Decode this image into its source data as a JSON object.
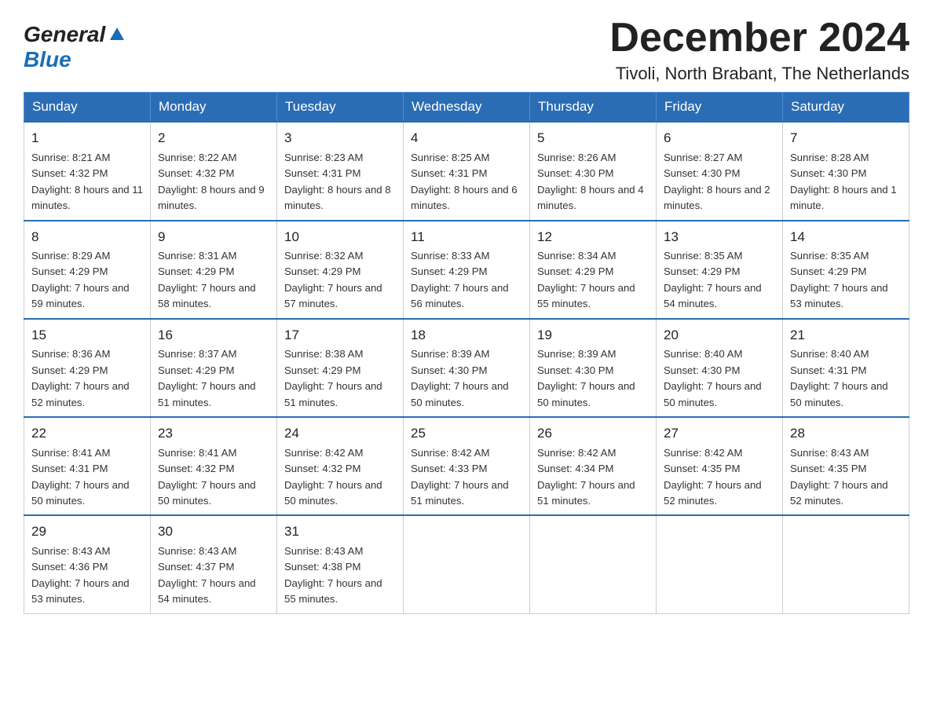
{
  "header": {
    "logo_general": "General",
    "logo_blue": "Blue",
    "title": "December 2024",
    "subtitle": "Tivoli, North Brabant, The Netherlands"
  },
  "days_of_week": [
    "Sunday",
    "Monday",
    "Tuesday",
    "Wednesday",
    "Thursday",
    "Friday",
    "Saturday"
  ],
  "weeks": [
    [
      {
        "day": "1",
        "sunrise": "8:21 AM",
        "sunset": "4:32 PM",
        "daylight": "8 hours and 11 minutes."
      },
      {
        "day": "2",
        "sunrise": "8:22 AM",
        "sunset": "4:32 PM",
        "daylight": "8 hours and 9 minutes."
      },
      {
        "day": "3",
        "sunrise": "8:23 AM",
        "sunset": "4:31 PM",
        "daylight": "8 hours and 8 minutes."
      },
      {
        "day": "4",
        "sunrise": "8:25 AM",
        "sunset": "4:31 PM",
        "daylight": "8 hours and 6 minutes."
      },
      {
        "day": "5",
        "sunrise": "8:26 AM",
        "sunset": "4:30 PM",
        "daylight": "8 hours and 4 minutes."
      },
      {
        "day": "6",
        "sunrise": "8:27 AM",
        "sunset": "4:30 PM",
        "daylight": "8 hours and 2 minutes."
      },
      {
        "day": "7",
        "sunrise": "8:28 AM",
        "sunset": "4:30 PM",
        "daylight": "8 hours and 1 minute."
      }
    ],
    [
      {
        "day": "8",
        "sunrise": "8:29 AM",
        "sunset": "4:29 PM",
        "daylight": "7 hours and 59 minutes."
      },
      {
        "day": "9",
        "sunrise": "8:31 AM",
        "sunset": "4:29 PM",
        "daylight": "7 hours and 58 minutes."
      },
      {
        "day": "10",
        "sunrise": "8:32 AM",
        "sunset": "4:29 PM",
        "daylight": "7 hours and 57 minutes."
      },
      {
        "day": "11",
        "sunrise": "8:33 AM",
        "sunset": "4:29 PM",
        "daylight": "7 hours and 56 minutes."
      },
      {
        "day": "12",
        "sunrise": "8:34 AM",
        "sunset": "4:29 PM",
        "daylight": "7 hours and 55 minutes."
      },
      {
        "day": "13",
        "sunrise": "8:35 AM",
        "sunset": "4:29 PM",
        "daylight": "7 hours and 54 minutes."
      },
      {
        "day": "14",
        "sunrise": "8:35 AM",
        "sunset": "4:29 PM",
        "daylight": "7 hours and 53 minutes."
      }
    ],
    [
      {
        "day": "15",
        "sunrise": "8:36 AM",
        "sunset": "4:29 PM",
        "daylight": "7 hours and 52 minutes."
      },
      {
        "day": "16",
        "sunrise": "8:37 AM",
        "sunset": "4:29 PM",
        "daylight": "7 hours and 51 minutes."
      },
      {
        "day": "17",
        "sunrise": "8:38 AM",
        "sunset": "4:29 PM",
        "daylight": "7 hours and 51 minutes."
      },
      {
        "day": "18",
        "sunrise": "8:39 AM",
        "sunset": "4:30 PM",
        "daylight": "7 hours and 50 minutes."
      },
      {
        "day": "19",
        "sunrise": "8:39 AM",
        "sunset": "4:30 PM",
        "daylight": "7 hours and 50 minutes."
      },
      {
        "day": "20",
        "sunrise": "8:40 AM",
        "sunset": "4:30 PM",
        "daylight": "7 hours and 50 minutes."
      },
      {
        "day": "21",
        "sunrise": "8:40 AM",
        "sunset": "4:31 PM",
        "daylight": "7 hours and 50 minutes."
      }
    ],
    [
      {
        "day": "22",
        "sunrise": "8:41 AM",
        "sunset": "4:31 PM",
        "daylight": "7 hours and 50 minutes."
      },
      {
        "day": "23",
        "sunrise": "8:41 AM",
        "sunset": "4:32 PM",
        "daylight": "7 hours and 50 minutes."
      },
      {
        "day": "24",
        "sunrise": "8:42 AM",
        "sunset": "4:32 PM",
        "daylight": "7 hours and 50 minutes."
      },
      {
        "day": "25",
        "sunrise": "8:42 AM",
        "sunset": "4:33 PM",
        "daylight": "7 hours and 51 minutes."
      },
      {
        "day": "26",
        "sunrise": "8:42 AM",
        "sunset": "4:34 PM",
        "daylight": "7 hours and 51 minutes."
      },
      {
        "day": "27",
        "sunrise": "8:42 AM",
        "sunset": "4:35 PM",
        "daylight": "7 hours and 52 minutes."
      },
      {
        "day": "28",
        "sunrise": "8:43 AM",
        "sunset": "4:35 PM",
        "daylight": "7 hours and 52 minutes."
      }
    ],
    [
      {
        "day": "29",
        "sunrise": "8:43 AM",
        "sunset": "4:36 PM",
        "daylight": "7 hours and 53 minutes."
      },
      {
        "day": "30",
        "sunrise": "8:43 AM",
        "sunset": "4:37 PM",
        "daylight": "7 hours and 54 minutes."
      },
      {
        "day": "31",
        "sunrise": "8:43 AM",
        "sunset": "4:38 PM",
        "daylight": "7 hours and 55 minutes."
      },
      null,
      null,
      null,
      null
    ]
  ],
  "labels": {
    "sunrise": "Sunrise:",
    "sunset": "Sunset:",
    "daylight": "Daylight:"
  }
}
